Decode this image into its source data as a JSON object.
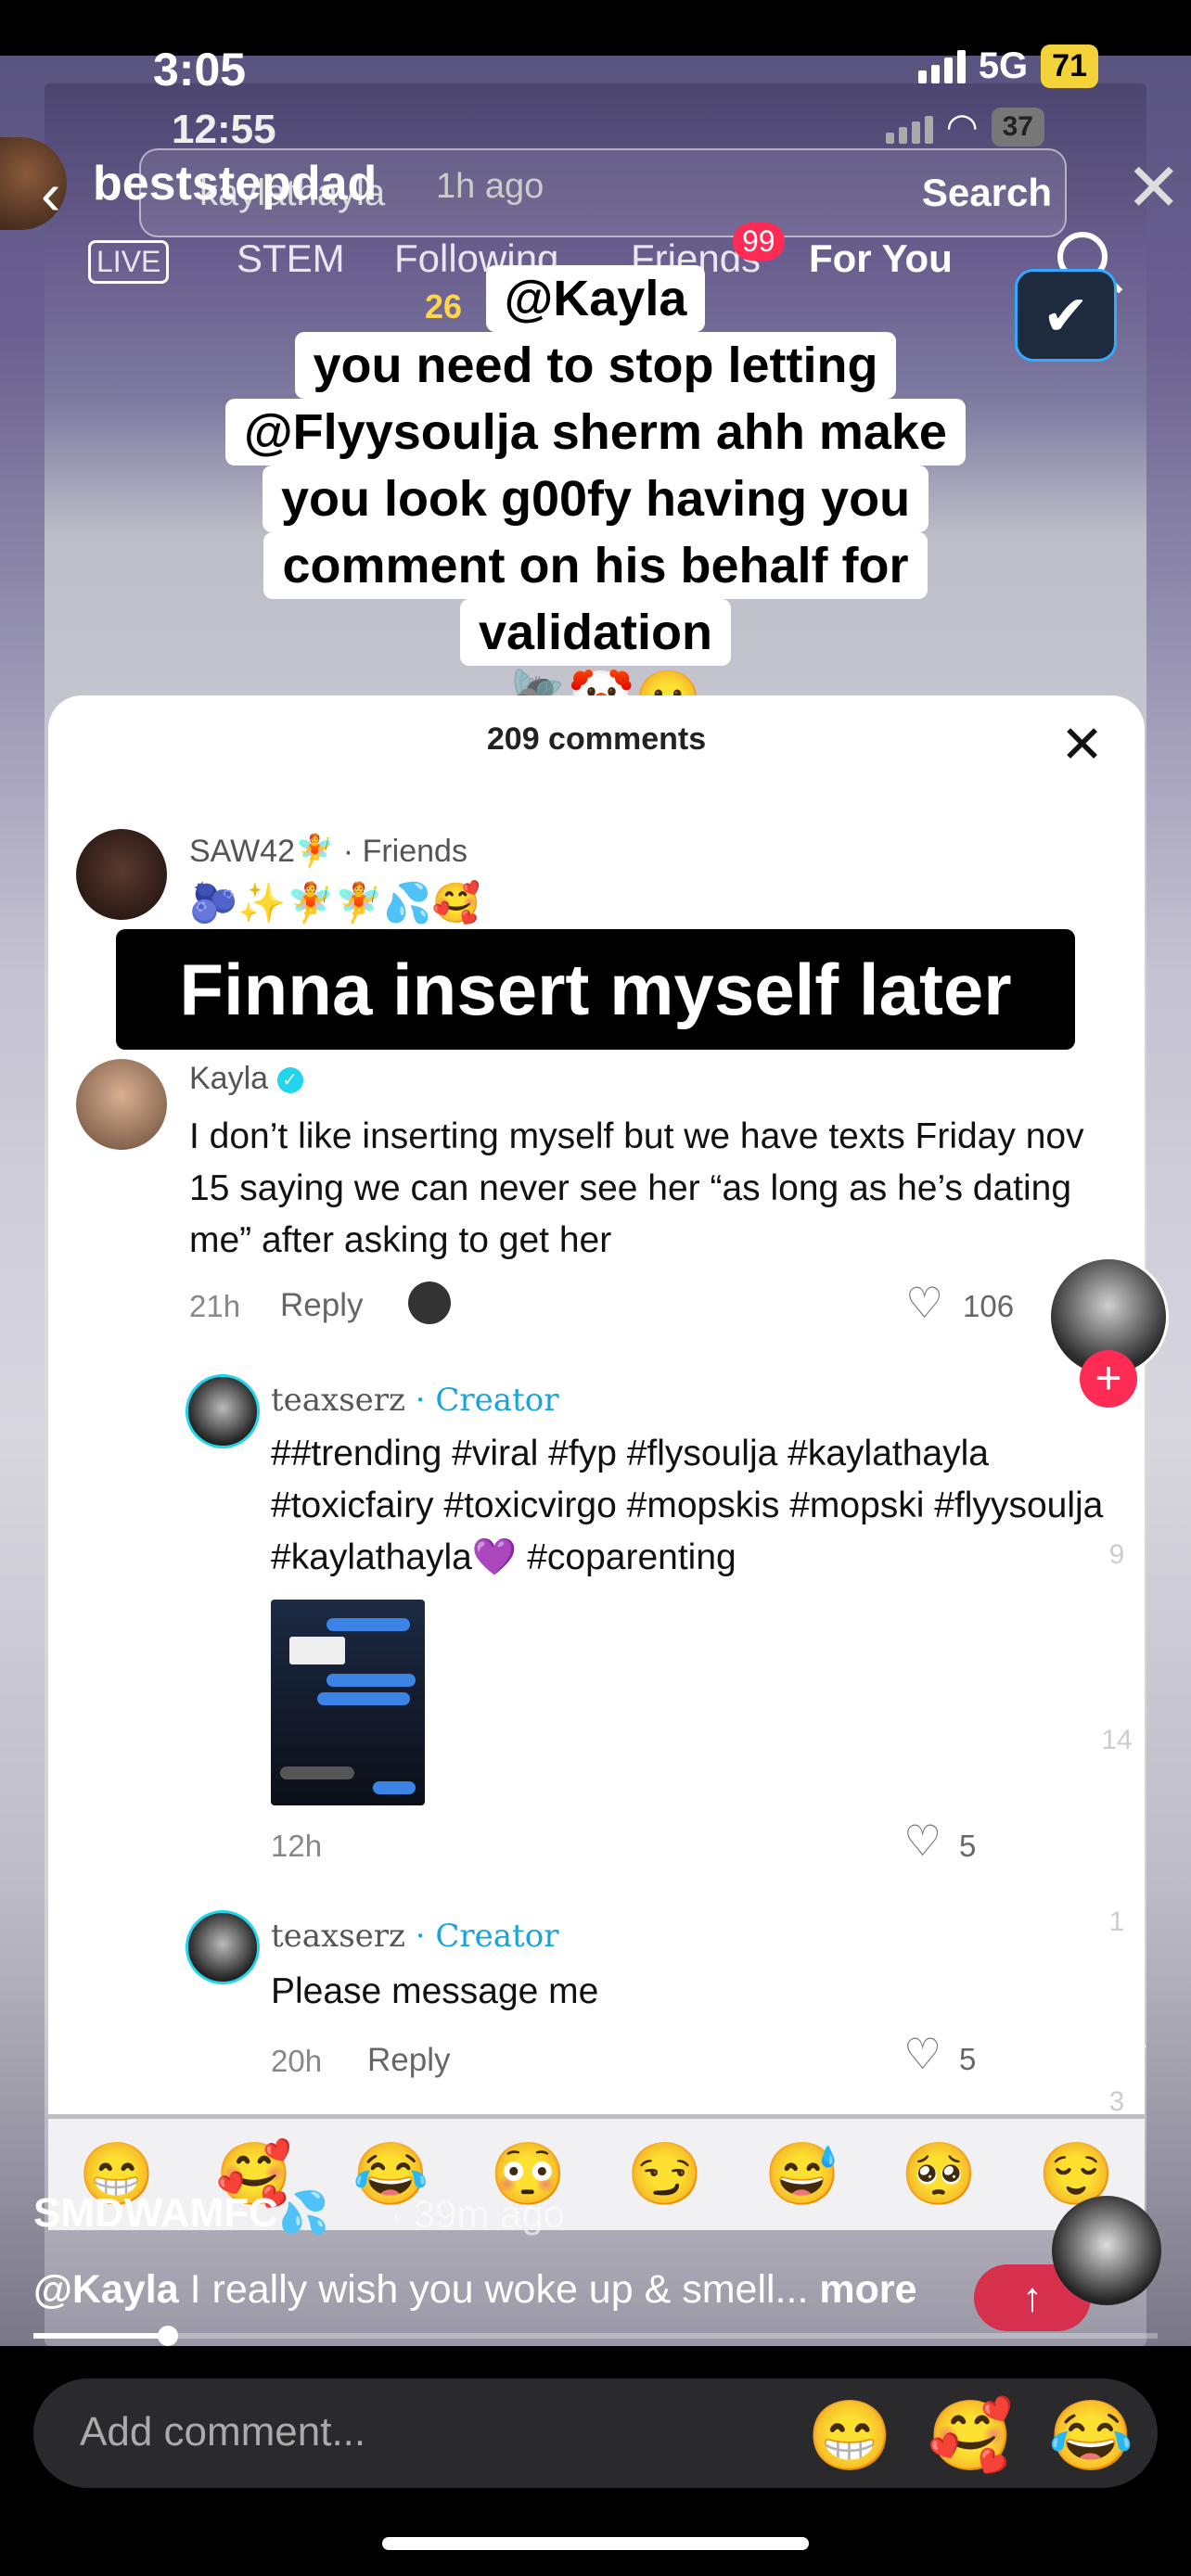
{
  "status_outer": {
    "time": "3:05",
    "network": "5G",
    "battery": "71"
  },
  "status_inner": {
    "time": "12:55",
    "battery": "37"
  },
  "header": {
    "username": "beststepdad",
    "search_query": "kaylathayla",
    "time_ago": "1h ago",
    "search_button": "Search"
  },
  "feed_tabs": {
    "live": "LIVE",
    "stem": "STEM",
    "following": "Following",
    "friends": "Friends",
    "friends_badge": "99",
    "for_you": "For You",
    "small_number": "26"
  },
  "caption": {
    "lines": [
      "@Kayla",
      "you need to stop letting",
      "@Flyysoulja sherm ahh make",
      "you look g00fy having you",
      "comment on his behalf for",
      "validation"
    ],
    "emojis": "🪰🤡🫤"
  },
  "comments_sheet": {
    "title": "209 comments",
    "overlay_text": "Finna insert myself later",
    "comment1": {
      "user": "SAW42🧚",
      "tag": "· Friends",
      "text": "🫐✨🧚🧚💦🥰"
    },
    "comment2": {
      "user": "Kayla",
      "text": "I don’t like inserting myself but we have texts Friday nov 15 saying we can never see her “as long as he’s dating me” after asking to get her",
      "time": "21h",
      "reply": "Reply",
      "likes": "106"
    },
    "reply1": {
      "user": "teaxserz",
      "role": "· Creator",
      "text": "##trending #viral #fyp #flysoulja #kaylathayla #toxicfairy #toxicvirgo #mopskis #mopski #flyysoulja #kaylathayla💜 #coparenting",
      "time": "12h",
      "likes": "5"
    },
    "reply2": {
      "user": "teaxserz",
      "role": "· Creator",
      "text": "Please message me",
      "time": "20h",
      "reply": "Reply",
      "likes": "5"
    }
  },
  "rail": {
    "likes": "9",
    "comments": "14",
    "saves": "1",
    "shares": "3"
  },
  "emoji_bar": [
    "😁",
    "🥰",
    "😂",
    "😳",
    "😏",
    "😅",
    "🥺",
    "😌"
  ],
  "video": {
    "user": "SMDWAMFC💦",
    "time": "· 39m ago",
    "caption_mention": "@Kayla",
    "caption_text": " I really wish you woke up & smell...",
    "more": " more",
    "send_glyph": "↑"
  },
  "progress": {
    "fraction": 0.12
  },
  "input": {
    "placeholder": "Add comment...",
    "quick_emojis": [
      "😁",
      "🥰",
      "😂"
    ]
  }
}
